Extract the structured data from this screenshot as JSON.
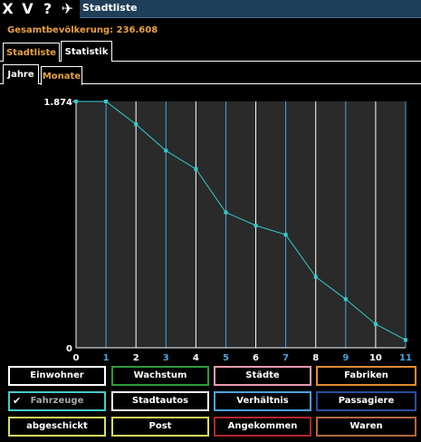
{
  "window": {
    "title": "Stadtliste"
  },
  "titlebar_buttons": [
    {
      "glyph": "X",
      "icon": "close-icon"
    },
    {
      "glyph": "V",
      "icon": "collapse-icon"
    },
    {
      "glyph": "?",
      "icon": "help-icon"
    },
    {
      "glyph": "✈",
      "icon": "pin-icon"
    }
  ],
  "population": {
    "text": "Gesamtbevölkerung: 236.608"
  },
  "tabs": {
    "main": [
      {
        "label": "Stadtliste",
        "active": false
      },
      {
        "label": "Statistik",
        "active": true
      }
    ],
    "sub": [
      {
        "label": "Jahre",
        "active": true
      },
      {
        "label": "Monate",
        "active": false
      }
    ]
  },
  "chart_data": {
    "type": "line",
    "x": [
      0,
      1,
      2,
      3,
      4,
      5,
      6,
      7,
      8,
      9,
      10,
      11
    ],
    "series": [
      {
        "values": [
          1874,
          1874,
          1700,
          1500,
          1360,
          1030,
          930,
          860,
          540,
          370,
          180,
          60
        ],
        "color": "#33cccc"
      }
    ],
    "ylim": [
      0,
      1874
    ],
    "yticks": [
      "1.874",
      "0"
    ],
    "xticks": [
      "0",
      "1",
      "2",
      "3",
      "4",
      "5",
      "6",
      "7",
      "8",
      "9",
      "10",
      "11"
    ],
    "xtick_colors": [
      "#ffffff",
      "#4aa3df",
      "#ffffff",
      "#4aa3df",
      "#ffffff",
      "#4aa3df",
      "#ffffff",
      "#4aa3df",
      "#ffffff",
      "#4aa3df",
      "#ffffff",
      "#4aa3df"
    ],
    "grid": true,
    "colors": {
      "background": "#2a2a2a",
      "axis": "#ffffff"
    }
  },
  "buttons": [
    [
      {
        "label": "Einwohner",
        "border": "#ffffff"
      },
      {
        "label": "Wachstum",
        "border": "#2e9a3a"
      },
      {
        "label": "Städte",
        "border": "#e89ab0"
      },
      {
        "label": "Fabriken",
        "border": "#e08a30"
      }
    ],
    [
      {
        "label": "Fahrzeuge",
        "border": "#44cccc",
        "checked": true,
        "color": "#aaaaaa",
        "check": "✔"
      },
      {
        "label": "Stadtautos",
        "border": "#ffffff"
      },
      {
        "label": "Verhältnis",
        "border": "#4aa3df"
      },
      {
        "label": "Passagiere",
        "border": "#2a4fa0"
      }
    ],
    [
      {
        "label": "abgeschickt",
        "border": "#d8e060"
      },
      {
        "label": "Post",
        "border": "#d8e060"
      },
      {
        "label": "Angekommen",
        "border": "#b0282a"
      },
      {
        "label": "Waren",
        "border": "#b06a40"
      }
    ]
  ]
}
